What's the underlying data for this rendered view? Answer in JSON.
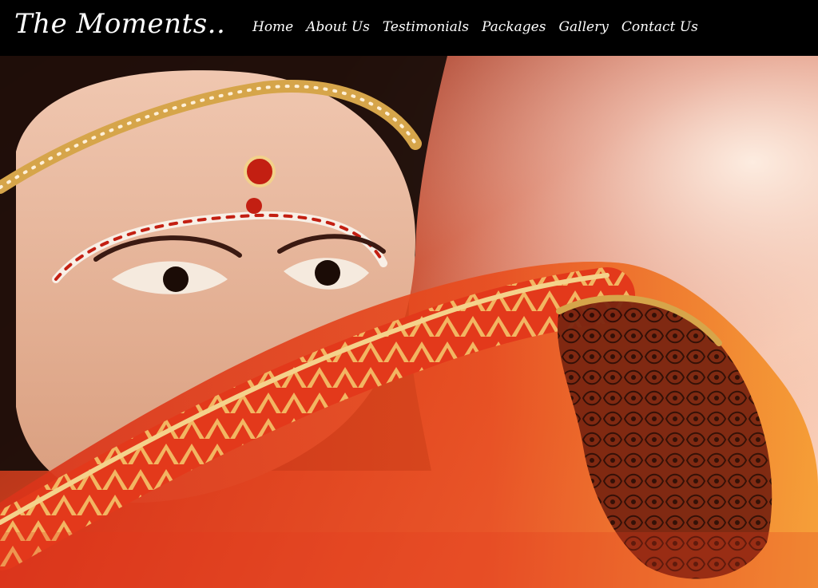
{
  "header": {
    "brand": "The Moments..",
    "nav": [
      {
        "label": "Home"
      },
      {
        "label": "About Us"
      },
      {
        "label": "Testimonials"
      },
      {
        "label": "Packages"
      },
      {
        "label": "Gallery"
      },
      {
        "label": "Contact Us"
      }
    ]
  },
  "hero": {
    "subject": "bride-portrait-photo",
    "colors": {
      "background_top_right": "#f6d7c4",
      "veil_red": "#e2421a",
      "veil_orange": "#f07a2a",
      "gold": "#d6a54a",
      "skin": "#e7b497",
      "hair": "#1a0e0a"
    }
  }
}
